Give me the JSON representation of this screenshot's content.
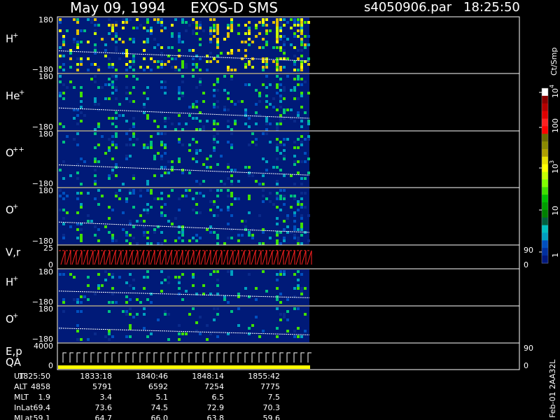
{
  "header": {
    "date": "May 09, 1994",
    "instrument": "EXOS-D SMS",
    "file": "s4050906.par",
    "time": "18:25:50"
  },
  "panels": [
    {
      "label": "H",
      "sup": "+",
      "top_tick": "180",
      "bottom_tick": "−180"
    },
    {
      "label": "He",
      "sup": "+",
      "top_tick": "180",
      "bottom_tick": "−180"
    },
    {
      "label": "O",
      "sup": "++",
      "top_tick": "180",
      "bottom_tick": "−180"
    },
    {
      "label": "O",
      "sup": "+",
      "top_tick": "180",
      "bottom_tick": "−180"
    },
    {
      "label": "V,r",
      "sup": "",
      "top_tick": "25",
      "bottom_tick": "0",
      "right_top": "90",
      "right_bottom": "0"
    },
    {
      "label": "H",
      "sup": "+",
      "top_tick": "180",
      "bottom_tick": "−180"
    },
    {
      "label": "O",
      "sup": "+",
      "top_tick": "180",
      "bottom_tick": "−180"
    },
    {
      "label": "E,p",
      "label2": "QA",
      "sup": "",
      "top_tick": "4000",
      "bottom_tick": "0",
      "right_top": "90",
      "right_bottom": "0"
    }
  ],
  "colorbar": {
    "unit": "Ct/Smp",
    "tick_labels": [
      "10",
      "100",
      "10",
      "10",
      "1"
    ],
    "tick_sups": [
      "4",
      "",
      "3",
      "",
      ""
    ],
    "colors": [
      "#ffffff",
      "#8b0000",
      "#b40000",
      "#e00000",
      "#ff2020",
      "#ff0000",
      "#6b6b00",
      "#8a8a00",
      "#b0a000",
      "#e8e000",
      "#ffff00",
      "#c8ff00",
      "#80ff00",
      "#40e000",
      "#00c000",
      "#00a000",
      "#008000",
      "#006040",
      "#00c0c0",
      "#00a0c0",
      "#0050c0",
      "#0030a0",
      "#001880"
    ]
  },
  "footer": {
    "rows": [
      {
        "label": "UT",
        "values": [
          "1825:50",
          "1833:18",
          "1840:46",
          "1848:14",
          "1855:42"
        ]
      },
      {
        "label": "ALT",
        "values": [
          "4858",
          "5791",
          "6592",
          "7254",
          "7775"
        ]
      },
      {
        "label": "MLT",
        "values": [
          "1.9",
          "3.4",
          "5.1",
          "6.5",
          "7.5"
        ]
      },
      {
        "label": "InLat",
        "values": [
          "69.4",
          "73.6",
          "74.5",
          "72.9",
          "70.3"
        ]
      },
      {
        "label": "MLat",
        "values": [
          "59.1",
          "64.7",
          "66.0",
          "63.8",
          "59.6"
        ]
      }
    ],
    "version": "Feb-01 2AA32L"
  },
  "chart_data": {
    "type": "heatmap",
    "title": "May 09, 1994   EXOS-D SMS",
    "x": [
      "1825:50",
      "1833:18",
      "1840:46",
      "1848:14",
      "1855:42"
    ],
    "xlabel": "UT",
    "ylim": [
      -180,
      180
    ],
    "colorscale": "log",
    "color_range": [
      1,
      10000
    ],
    "color_unit": "Ct/Smp",
    "series": [
      {
        "name": "H+",
        "ylim": [
          -180,
          180
        ]
      },
      {
        "name": "He+",
        "ylim": [
          -180,
          180
        ]
      },
      {
        "name": "O++",
        "ylim": [
          -180,
          180
        ]
      },
      {
        "name": "O+",
        "ylim": [
          -180,
          180
        ]
      },
      {
        "name": "V,r",
        "ylim": [
          0,
          25
        ],
        "right_ylim": [
          0,
          90
        ]
      },
      {
        "name": "H+",
        "ylim": [
          -180,
          180
        ]
      },
      {
        "name": "O+",
        "ylim": [
          -180,
          180
        ]
      },
      {
        "name": "E,p",
        "ylim": [
          0,
          4000
        ],
        "right_ylim": [
          0,
          90
        ]
      }
    ]
  }
}
